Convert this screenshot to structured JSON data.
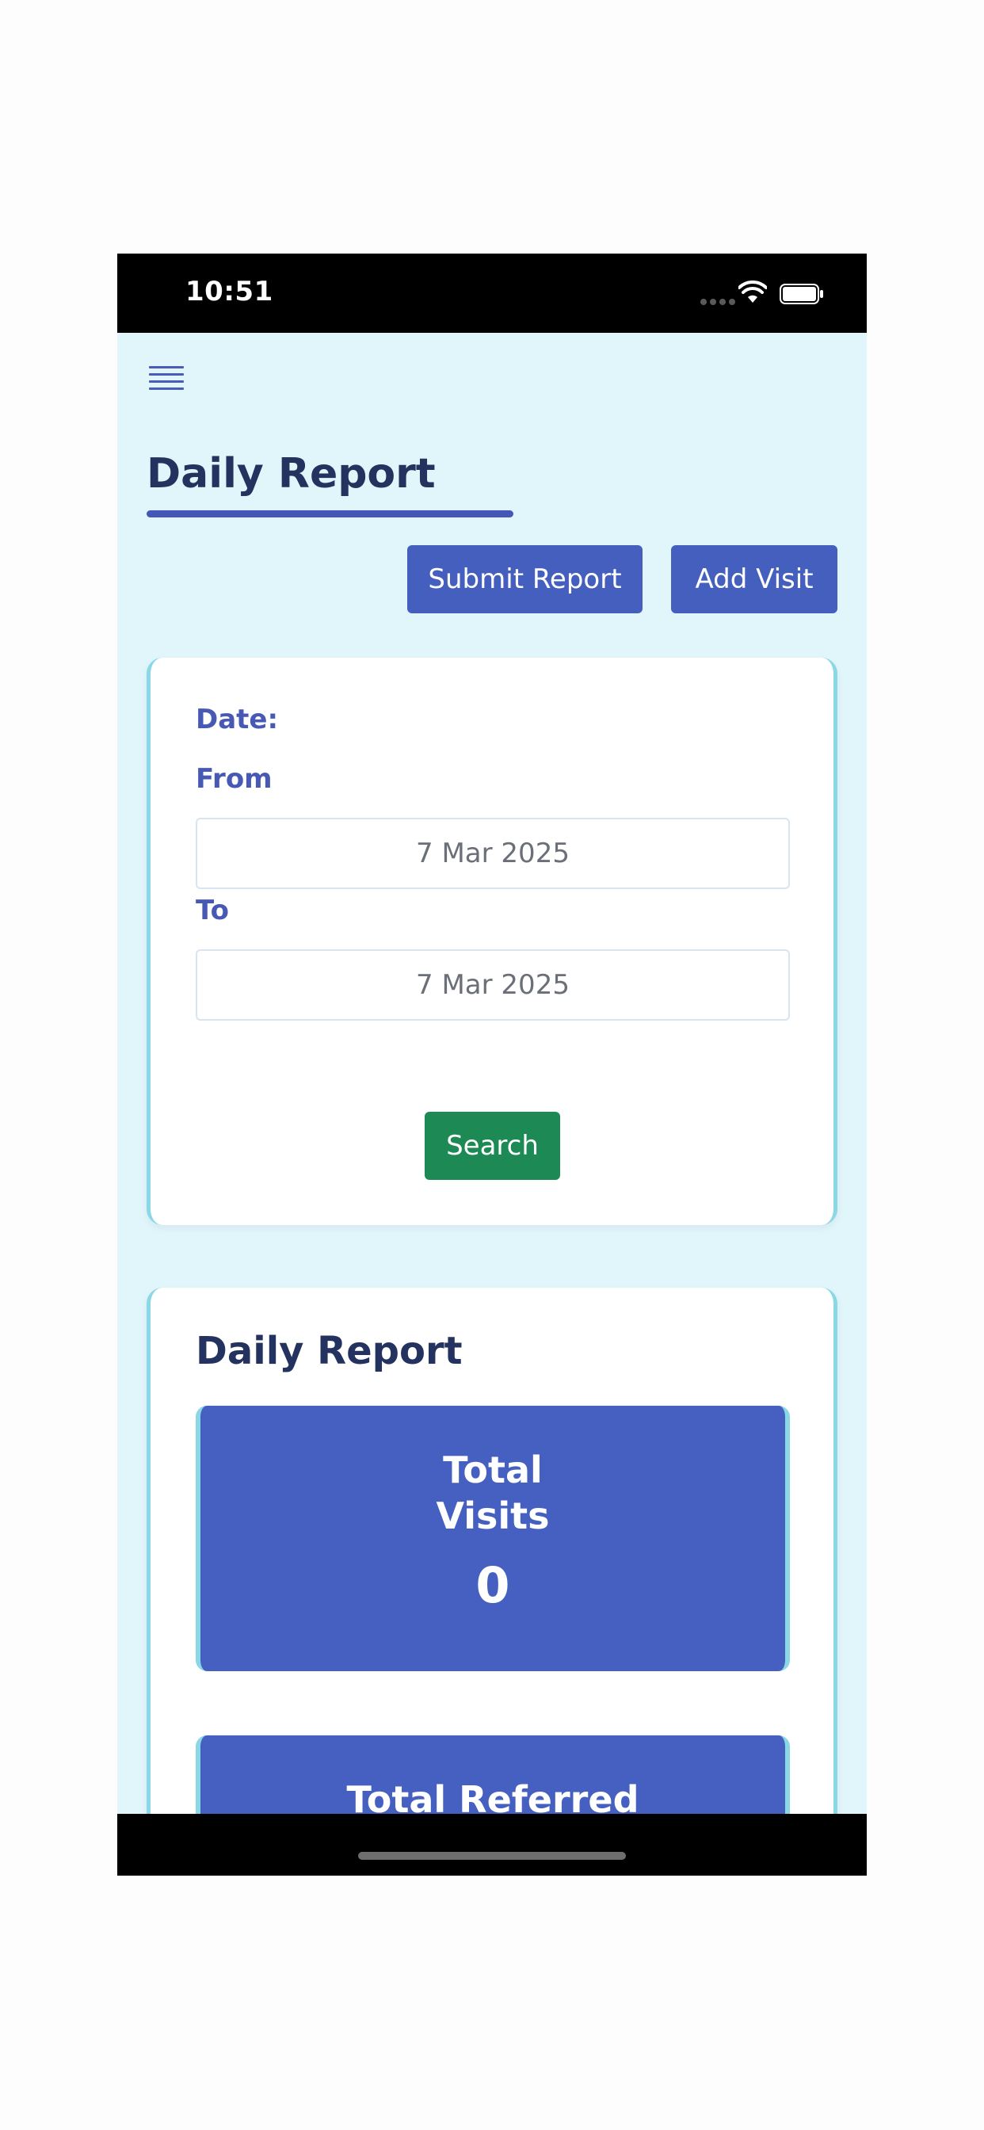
{
  "status_bar": {
    "time": "10:51",
    "icons": [
      "signal-dots-icon",
      "wifi-icon",
      "battery-icon"
    ]
  },
  "header": {
    "menu_icon": "hamburger-menu-icon",
    "title": "Daily Report",
    "accent_color": "#4556b8"
  },
  "actions": {
    "submit_label": "Submit Report",
    "add_visit_label": "Add Visit"
  },
  "filter": {
    "date_label": "Date:",
    "from_label": "From",
    "from_value": "7 Mar 2025",
    "to_label": "To",
    "to_value": "7 Mar 2025",
    "search_label": "Search",
    "search_color": "#1d8a55"
  },
  "report": {
    "title": "Daily Report",
    "stats": [
      {
        "label": "Total Visits",
        "value": "0"
      },
      {
        "label": "Total Referred",
        "value": ""
      }
    ],
    "tile_color": "#4560c0"
  }
}
